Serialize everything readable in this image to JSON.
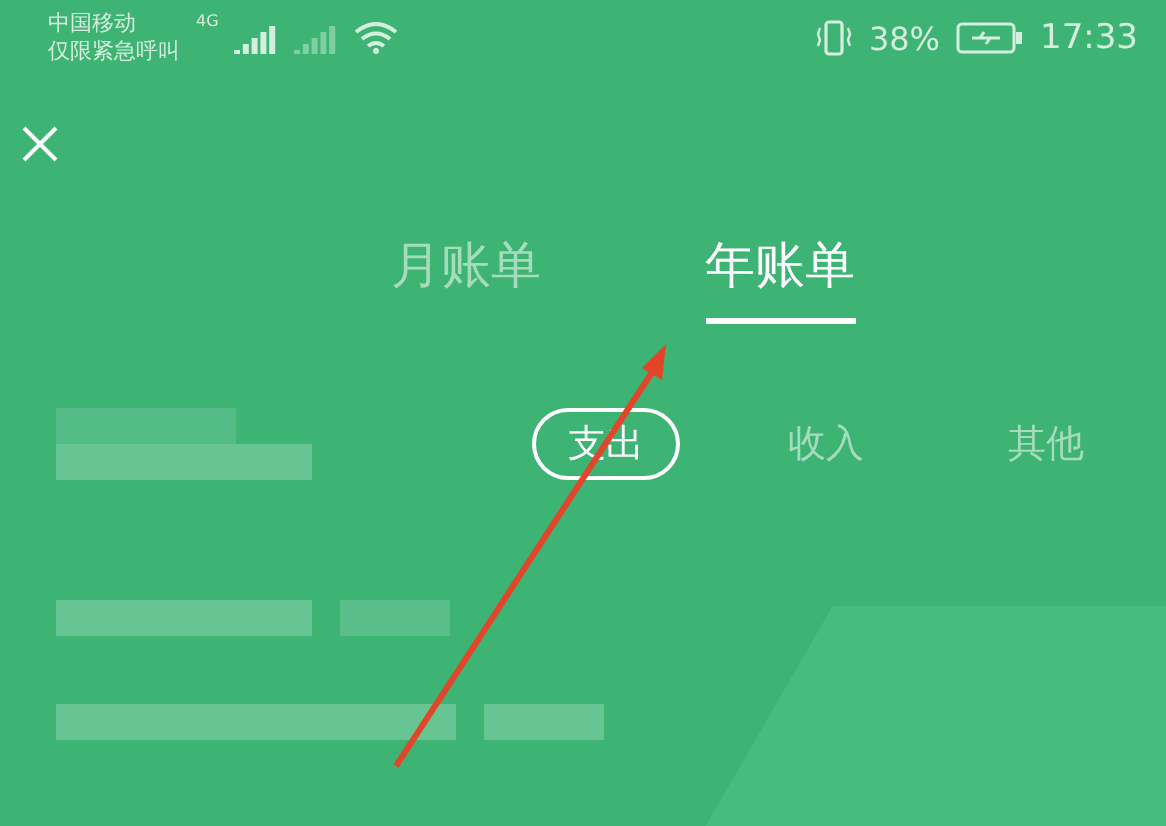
{
  "status_bar": {
    "carrier": "中国移动",
    "carrier_note": "仅限紧急呼叫",
    "network": "4G",
    "battery": "38%",
    "time": "17:33"
  },
  "tabs": [
    {
      "label": "月账单",
      "selected": false
    },
    {
      "label": "年账单",
      "selected": true
    }
  ],
  "filters": [
    {
      "label": "支出",
      "selected": true
    },
    {
      "label": "收入",
      "selected": false
    },
    {
      "label": "其他",
      "selected": false
    }
  ]
}
